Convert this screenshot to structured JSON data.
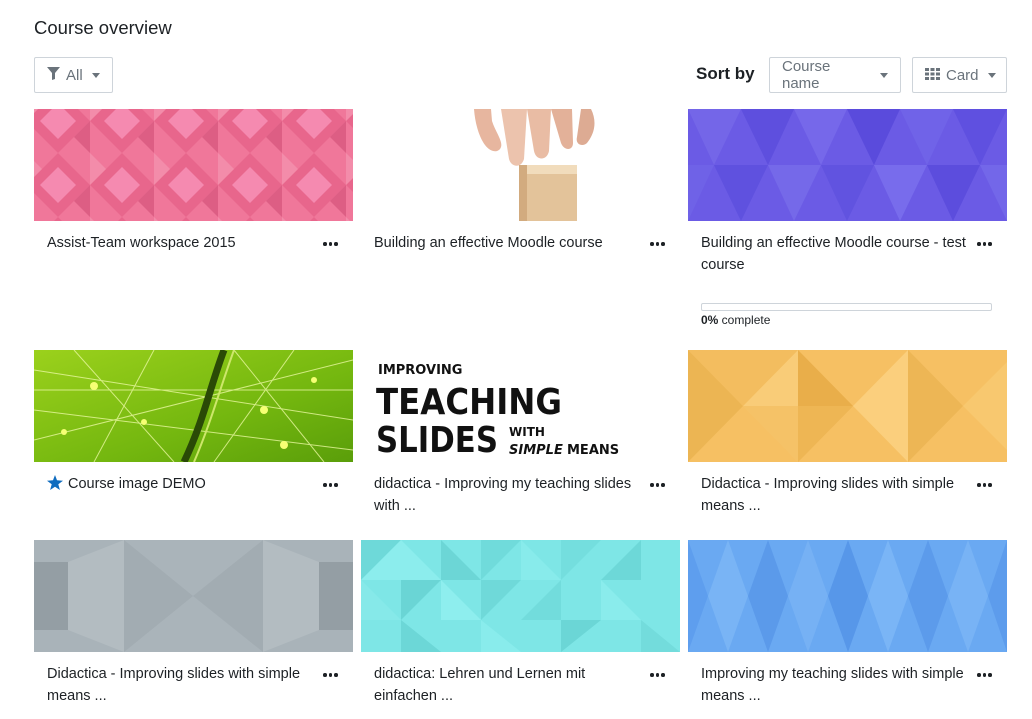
{
  "page": {
    "title": "Course overview"
  },
  "filter": {
    "label": "All",
    "icon": "filter-icon"
  },
  "sort": {
    "label": "Sort by",
    "value": "Course name"
  },
  "view": {
    "label": "Card",
    "icon": "grid-icon"
  },
  "colors": {
    "primary": "#0f6cbf",
    "star": "#0f6cbf"
  },
  "banner": {
    "line1": "IMPROVING",
    "line2": "TEACHING",
    "line3": "SLIDES",
    "with": "WITH",
    "simple": "SIMPLE",
    "means": "MEANS"
  },
  "courses": [
    {
      "title": "Assist-Team workspace 2015",
      "image": "pink-diamond-pattern"
    },
    {
      "title": "Building an effective Moodle course",
      "image": "hand-holding-block-photo"
    },
    {
      "title": "Building an effective Moodle course - test course",
      "image": "purple-triangle-pattern",
      "progress": 0,
      "progress_value": "0%",
      "progress_suffix": " complete"
    },
    {
      "title": "Course image DEMO",
      "image": "green-network-photo",
      "starred": true
    },
    {
      "title": "didactica - Improving my teaching slides with ...",
      "image": "improving-teaching-slides-banner"
    },
    {
      "title": "Didactica - Improving slides with simple means ...",
      "image": "yellow-triangle-pattern"
    },
    {
      "title": "Didactica - Improving slides with simple means ...",
      "image": "grey-octagon-pattern"
    },
    {
      "title": "didactica: Lehren und Lernen mit einfachen ...",
      "image": "cyan-triangle-pattern"
    },
    {
      "title": "Improving my teaching slides with simple means ...",
      "image": "blue-diamond-pattern"
    }
  ]
}
